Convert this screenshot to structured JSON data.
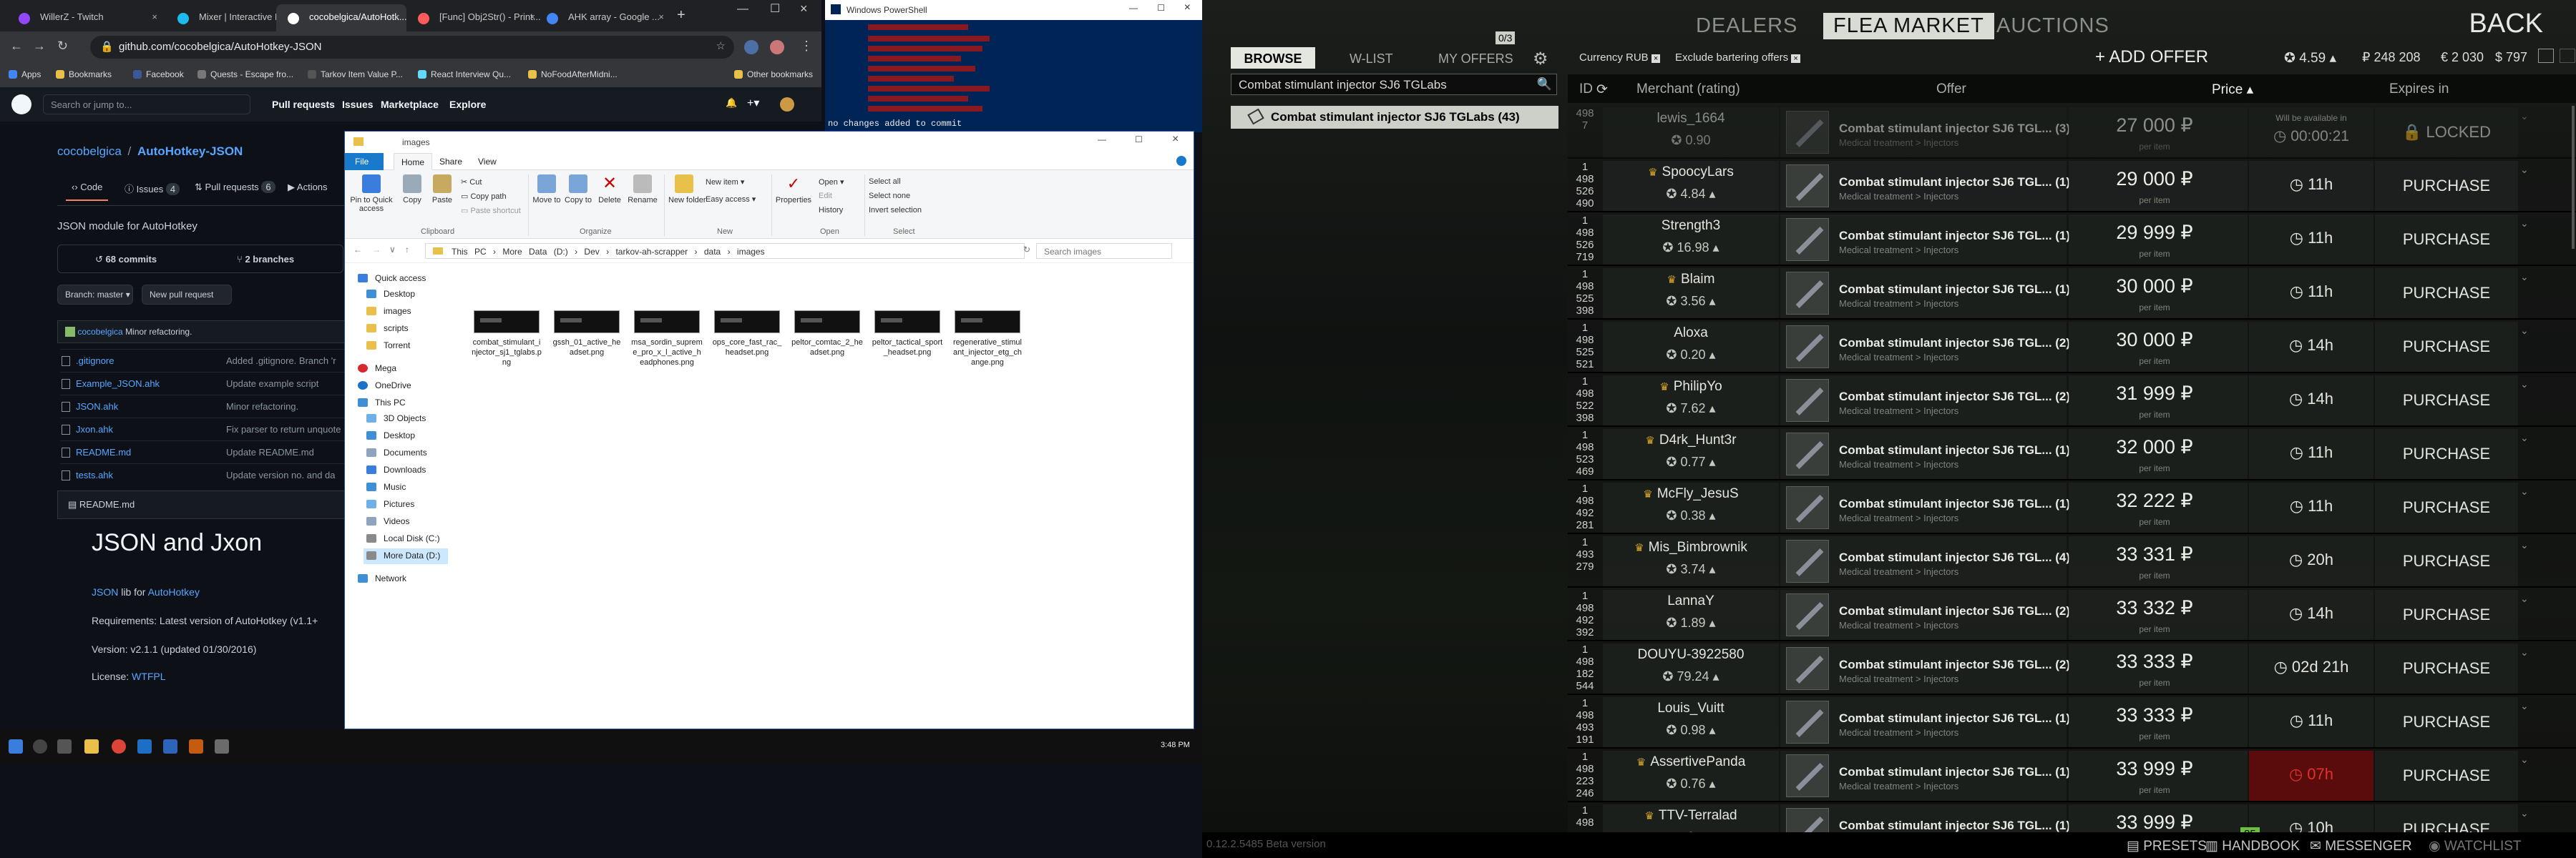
{
  "chrome": {
    "tabs": [
      {
        "label": "WillerZ - Twitch",
        "color": "#9146ff"
      },
      {
        "label": "Mixer | Interactive Liv...",
        "color": "#1fbaed"
      },
      {
        "label": "cocobelgica/AutoHotk...",
        "color": "#ffffff"
      },
      {
        "label": "[Func] Obj2Str() - Print...",
        "color": "#ff5b5b"
      },
      {
        "label": "AHK array - Google ...",
        "color": "#4285f4"
      }
    ],
    "url": "github.com/cocobelgica/AutoHotkey-JSON",
    "bookmarks": [
      "Apps",
      "Bookmarks",
      "Facebook",
      "Quests - Escape fro...",
      "Tarkov Item Value P...",
      "React Interview Qu...",
      "NoFoodAfterMidni...",
      "Other bookmarks"
    ]
  },
  "github": {
    "search_placeholder": "Search or jump to...",
    "nav": [
      "Pull requests",
      "Issues",
      "Marketplace",
      "Explore"
    ],
    "owner": "cocobelgica",
    "slash": "/",
    "repo": "AutoHotkey-JSON",
    "tabs": [
      {
        "label": "Code",
        "count": ""
      },
      {
        "label": "Issues",
        "count": "4"
      },
      {
        "label": "Pull requests",
        "count": "6"
      },
      {
        "label": "Actions",
        "count": ""
      }
    ],
    "description": "JSON module for AutoHotkey",
    "commits": "68 commits",
    "branches": "2 branches",
    "branch_label": "Branch: master ▾",
    "new_pr": "New pull request",
    "last_commit_author": "cocobelgica",
    "last_commit_msg": "Minor refactoring.",
    "files": [
      {
        "name": ".gitignore",
        "msg": "Added .gitignore. Branch 'r"
      },
      {
        "name": "Example_JSON.ahk",
        "msg": "Update example script"
      },
      {
        "name": "JSON.ahk",
        "msg": "Minor refactoring."
      },
      {
        "name": "Jxon.ahk",
        "msg": "Fix parser to return unquote"
      },
      {
        "name": "README.md",
        "msg": "Update README.md"
      },
      {
        "name": "tests.ahk",
        "msg": "Update version no. and da"
      }
    ],
    "readme_label": "README.md",
    "readme_title": "JSON and Jxon",
    "readme_line1_a": "JSON",
    "readme_line1_b": " lib for ",
    "readme_line1_c": "AutoHotkey",
    "readme_req": "Requirements: Latest version of AutoHotkey (v1.1+",
    "readme_version": "Version: v2.1.1 (updated 01/30/2016)",
    "readme_license_a": "License: ",
    "readme_license_b": "WTFPL"
  },
  "powershell": {
    "title": "Windows PowerShell",
    "bottom_text": "no changes added to commit"
  },
  "explorer": {
    "title": "images",
    "ribbon_tabs": [
      "File",
      "Home",
      "Share",
      "View"
    ],
    "buttons": {
      "pin": "Pin to Quick access",
      "copy": "Copy",
      "paste": "Paste",
      "cut": "Cut",
      "copy_path": "Copy path",
      "paste_shortcut": "Paste shortcut",
      "move_to": "Move to",
      "copy_to": "Copy to",
      "delete": "Delete",
      "rename": "Rename",
      "new_folder": "New folder",
      "new_item": "New item ▾",
      "easy_access": "Easy access ▾",
      "properties": "Properties",
      "open": "Open ▾",
      "edit": "Edit",
      "history": "History",
      "select_all": "Select all",
      "select_none": "Select none",
      "invert": "Invert selection"
    },
    "groups": [
      "Clipboard",
      "Organize",
      "New",
      "Open",
      "Select"
    ],
    "path": [
      "This PC",
      "›",
      "More Data (D:)",
      "›",
      "Dev",
      "›",
      "tarkov-ah-scrapper",
      "›",
      "data",
      "›",
      "images"
    ],
    "search_placeholder": "Search images",
    "nav": [
      {
        "label": "Quick access",
        "color": "#3b7ddd"
      },
      {
        "label": "Desktop",
        "color": "#3f8fd6"
      },
      {
        "label": "images",
        "color": "#e8c04a"
      },
      {
        "label": "scripts",
        "color": "#e8c04a"
      },
      {
        "label": "Torrent",
        "color": "#e8c04a"
      },
      {
        "label": "Mega",
        "color": "#d9272e"
      },
      {
        "label": "OneDrive",
        "color": "#1a73c9"
      },
      {
        "label": "This PC",
        "color": "#3f8fd6"
      },
      {
        "label": "3D Objects",
        "color": "#6fb0e8"
      },
      {
        "label": "Desktop",
        "color": "#3f8fd6"
      },
      {
        "label": "Documents",
        "color": "#8ea4bf"
      },
      {
        "label": "Downloads",
        "color": "#3b7ddd"
      },
      {
        "label": "Music",
        "color": "#3f8fd6"
      },
      {
        "label": "Pictures",
        "color": "#6fb0e8"
      },
      {
        "label": "Videos",
        "color": "#8ea4bf"
      },
      {
        "label": "Local Disk (C:)",
        "color": "#8a8a8a"
      },
      {
        "label": "More Data (D:)",
        "color": "#8a8a8a"
      },
      {
        "label": "Network",
        "color": "#3f8fd6"
      }
    ],
    "files": [
      "combat_stimulant_injector_sj1_tglabs.png",
      "gssh_01_active_headset.png",
      "msa_sordin_supreme_pro_x_l_active_headphones.png",
      "ops_core_fast_rac_headset.png",
      "peltor_comtac_2_headset.png",
      "peltor_tactical_sport_headset.png",
      "regenerative_stimulant_injector_etg_change.png"
    ]
  },
  "taskbar": {
    "time": "3:48 PM"
  },
  "game": {
    "top_tabs": [
      "DEALERS",
      "FLEA MARKET",
      "AUCTIONS"
    ],
    "back": "BACK",
    "sub_tabs": [
      "BROWSE",
      "W-LIST",
      "MY OFFERS"
    ],
    "offers_count": "0/3",
    "search_value": "Combat stimulant injector SJ6 TGLabs",
    "suggestion": "Combat stimulant injector SJ6 TGLabs (43)",
    "currency_label": "Currency RUB",
    "bartering_label": "Exclude bartering offers",
    "add_offer": "+ ADD OFFER",
    "rating": "4.59 ▴",
    "rub": "₽ 248 208",
    "eur": "€ 2 030",
    "usd": "$ 797",
    "headers": [
      "ID",
      "Merchant (rating)",
      "Offer",
      "Price ▴",
      "Expires in"
    ],
    "offer_category": "Medical treatment > Injectors",
    "per_item": "per item",
    "locked": "LOCKED",
    "available_in": "Will be available in",
    "available_time": "00:00:21",
    "rows": [
      {
        "id": [
          "498",
          "",
          "7"
        ],
        "merchant": "lewis_1664",
        "rating": "0.90",
        "crown": false,
        "offer": "Combat stimulant injector SJ6 TGL... (3)",
        "price": "27 000 ₽",
        "expires": "",
        "button": "LOCKED",
        "locked": true,
        "red": false
      },
      {
        "id": [
          "1",
          "498",
          "526",
          "490"
        ],
        "merchant": "SpoocyLars",
        "rating": "4.84 ▴",
        "crown": true,
        "offer": "Combat stimulant injector SJ6 TGL... (1)",
        "price": "29 000 ₽",
        "expires": "11h",
        "button": "PURCHASE",
        "locked": false,
        "red": false
      },
      {
        "id": [
          "1",
          "498",
          "526",
          "719"
        ],
        "merchant": "Strength3",
        "rating": "16.98 ▴",
        "crown": false,
        "offer": "Combat stimulant injector SJ6 TGL... (1)",
        "price": "29 999 ₽",
        "expires": "11h",
        "button": "PURCHASE",
        "locked": false,
        "red": false
      },
      {
        "id": [
          "1",
          "498",
          "525",
          "398"
        ],
        "merchant": "Blaim",
        "rating": "3.56 ▴",
        "crown": true,
        "offer": "Combat stimulant injector SJ6 TGL... (1)",
        "price": "30 000 ₽",
        "expires": "11h",
        "button": "PURCHASE",
        "locked": false,
        "red": false
      },
      {
        "id": [
          "1",
          "498",
          "525",
          "521"
        ],
        "merchant": "Aloxa",
        "rating": "0.20 ▴",
        "crown": false,
        "offer": "Combat stimulant injector SJ6 TGL... (2)",
        "price": "30 000 ₽",
        "expires": "14h",
        "button": "PURCHASE",
        "locked": false,
        "red": false
      },
      {
        "id": [
          "1",
          "498",
          "522",
          "398"
        ],
        "merchant": "PhilipYo",
        "rating": "7.62 ▴",
        "crown": true,
        "offer": "Combat stimulant injector SJ6 TGL... (2)",
        "price": "31 999 ₽",
        "expires": "14h",
        "button": "PURCHASE",
        "locked": false,
        "red": false
      },
      {
        "id": [
          "1",
          "498",
          "523",
          "469"
        ],
        "merchant": "D4rk_Hunt3r",
        "rating": "0.77 ▴",
        "crown": true,
        "offer": "Combat stimulant injector SJ6 TGL... (1)",
        "price": "32 000 ₽",
        "expires": "11h",
        "button": "PURCHASE",
        "locked": false,
        "red": false
      },
      {
        "id": [
          "1",
          "498",
          "492",
          "281"
        ],
        "merchant": "McFly_JesuS",
        "rating": "0.38 ▴",
        "crown": true,
        "offer": "Combat stimulant injector SJ6 TGL... (1)",
        "price": "32 222 ₽",
        "expires": "11h",
        "button": "PURCHASE",
        "locked": false,
        "red": false
      },
      {
        "id": [
          "1",
          "493",
          "279"
        ],
        "merchant": "Mis_Bimbrownik",
        "rating": "3.74 ▴",
        "crown": true,
        "offer": "Combat stimulant injector SJ6 TGL... (4)",
        "price": "33 331 ₽",
        "expires": "20h",
        "button": "PURCHASE",
        "locked": false,
        "red": false
      },
      {
        "id": [
          "1",
          "498",
          "492",
          "392"
        ],
        "merchant": "LannaY",
        "rating": "1.89 ▴",
        "crown": false,
        "offer": "Combat stimulant injector SJ6 TGL... (2)",
        "price": "33 332 ₽",
        "expires": "14h",
        "button": "PURCHASE",
        "locked": false,
        "red": false
      },
      {
        "id": [
          "1",
          "498",
          "182",
          "544"
        ],
        "merchant": "DOUYU-3922580",
        "rating": "79.24 ▴",
        "crown": false,
        "offer": "Combat stimulant injector SJ6 TGL... (2)",
        "price": "33 333 ₽",
        "expires": "02d 21h",
        "button": "PURCHASE",
        "locked": false,
        "red": false
      },
      {
        "id": [
          "1",
          "498",
          "493",
          "191"
        ],
        "merchant": "Louis_Vuitt",
        "rating": "0.98 ▴",
        "crown": false,
        "offer": "Combat stimulant injector SJ6 TGL... (1)",
        "price": "33 333 ₽",
        "expires": "11h",
        "button": "PURCHASE",
        "locked": false,
        "red": false
      },
      {
        "id": [
          "1",
          "498",
          "223",
          "246"
        ],
        "merchant": "AssertivePanda",
        "rating": "0.76 ▴",
        "crown": true,
        "offer": "Combat stimulant injector SJ6 TGL... (1)",
        "price": "33 999 ₽",
        "expires": "07h",
        "button": "PURCHASE",
        "locked": false,
        "red": true
      },
      {
        "id": [
          "1",
          "498"
        ],
        "merchant": "TTV-Terralad",
        "rating": "",
        "crown": true,
        "offer": "Combat stimulant injector SJ6 TGL... (1)",
        "price": "33 999 ₽",
        "expires": "10h",
        "button": "PURCHASE",
        "locked": false,
        "red": false,
        "badge": "85"
      }
    ],
    "bottom": [
      "PRESETS",
      "HANDBOOK",
      "MESSENGER",
      "WATCHLIST"
    ],
    "build": "0.12.2.5485 Beta version"
  }
}
